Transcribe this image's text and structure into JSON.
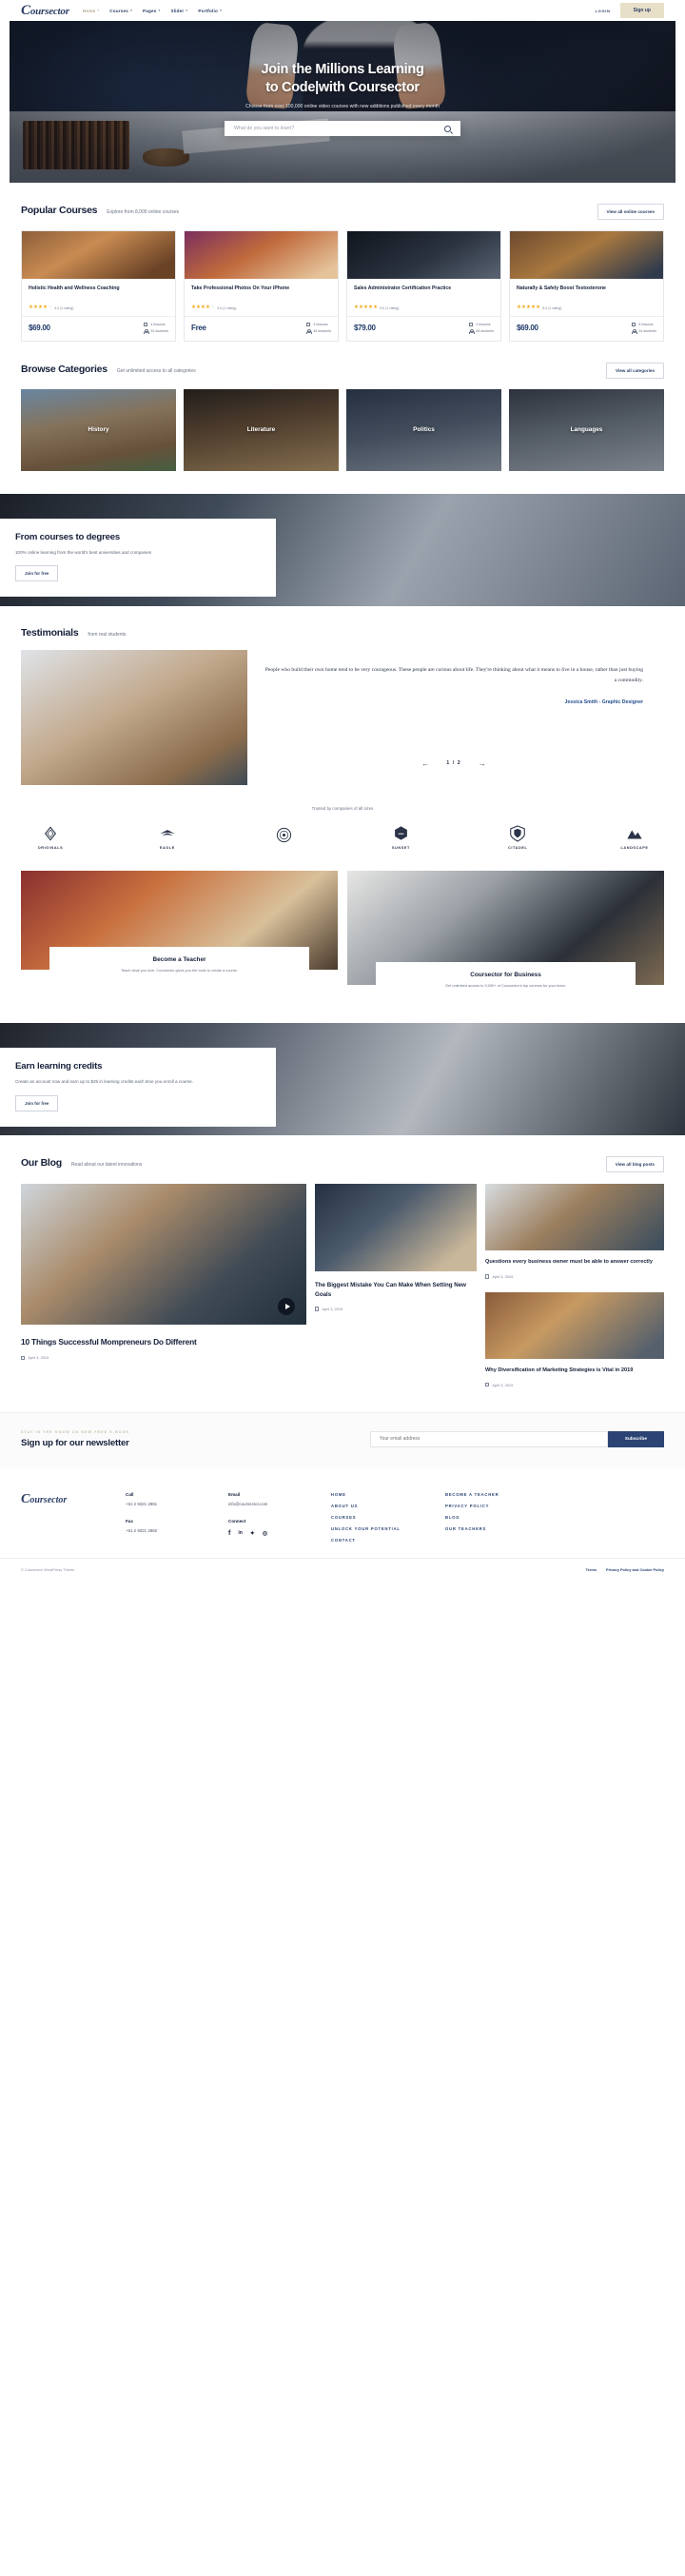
{
  "header": {
    "logo": "Coursector",
    "nav": [
      {
        "label": "Home",
        "caret": true,
        "muted": true
      },
      {
        "label": "Courses",
        "caret": true,
        "muted": false
      },
      {
        "label": "Pages",
        "caret": true,
        "muted": false
      },
      {
        "label": "Slider",
        "caret": true,
        "muted": false
      },
      {
        "label": "Portfolio",
        "caret": true,
        "muted": false
      }
    ],
    "login_label": "LOGIN",
    "signup_label": "Sign up"
  },
  "hero": {
    "title_line1": "Join the Millions Learning",
    "title_line2": "to Code|with Coursector",
    "subtitle": "Choose from over 100,000 online video courses with new additions published every month",
    "search_placeholder": "What do you want to learn?",
    "search_value": "",
    "search_icon": "search-icon"
  },
  "popular": {
    "title": "Popular Courses",
    "subtitle": "Explore from 8,000 online courses",
    "button": "View all online courses",
    "courses": [
      {
        "title": "Holistic Health and Wellness Coaching",
        "rating": 4.0,
        "stars_full": 4,
        "rating_text": "4.0 (1 rating)",
        "price": "$69.00",
        "lessons": "4 lessons",
        "students": "32 students"
      },
      {
        "title": "Take Professional Photos On Your iPhone",
        "rating": 4.0,
        "stars_full": 4,
        "rating_text": "4.0 (1 rating)",
        "price": "Free",
        "lessons": "4 lessons",
        "students": "45 students"
      },
      {
        "title": "Sales Administrator Certification Practice",
        "rating": 5.0,
        "stars_full": 5,
        "rating_text": "5.0 (1 rating)",
        "price": "$79.00",
        "lessons": "3 lessons",
        "students": "65 students"
      },
      {
        "title": "Naturally & Safely Boost Testosterone",
        "rating": 5.0,
        "stars_full": 5,
        "rating_text": "5.0 (1 rating)",
        "price": "$69.00",
        "lessons": "6 lessons",
        "students": "34 students"
      }
    ]
  },
  "categories": {
    "title": "Browse Categories",
    "subtitle": "Get unlimited access to all categories",
    "button": "View all categories",
    "items": [
      {
        "label": "History"
      },
      {
        "label": "Literature"
      },
      {
        "label": "Politics"
      },
      {
        "label": "Languages"
      }
    ]
  },
  "degrees_banner": {
    "title": "From courses to degrees",
    "text": "100% online learning from the world's best universities and companies",
    "button": "Join for free"
  },
  "testimonials": {
    "title": "Testimonials",
    "subtitle": "from real students",
    "quote": "People who build their own home tend to be very courageous. These people are curious about life. They're thinking about what it means to live in a house, rather than just buying a commodity.",
    "author": "Jessica Smith - Graphic Designer",
    "page": "1 / 2",
    "prev_icon": "arrow-left-icon",
    "next_icon": "arrow-right-icon"
  },
  "trusted": {
    "label": "Trusted by companies of all sizes",
    "brands": [
      {
        "name": "ORIGINALS",
        "mark": "diamond-icon"
      },
      {
        "name": "EAGLE",
        "mark": "eagle-icon"
      },
      {
        "name": "",
        "mark": "circle-emblem-icon"
      },
      {
        "name": "SUNSET",
        "mark": "hexagon-icon"
      },
      {
        "name": "CITADEL",
        "mark": "shield-icon"
      },
      {
        "name": "LANDSCAPE",
        "mark": "mountain-icon"
      }
    ]
  },
  "promos": [
    {
      "title": "Become a Teacher",
      "text": "Teach what you love. Coursector gives you the tools to create a course."
    },
    {
      "title": "Coursector for Business",
      "text": "Get unlimited access to 3,000+ of Coursector's top courses for your team."
    }
  ],
  "credits_banner": {
    "title": "Earn learning credits",
    "text": "Create an account now and earn up to $25 in learning credits each time you enroll a course.",
    "button": "Join for free"
  },
  "blog": {
    "title": "Our Blog",
    "subtitle": "Read about our latest innovations",
    "button": "View all blog posts",
    "main": {
      "title": "10 Things Successful Mompreneurs Do Different",
      "date": "April 3, 2019",
      "play_icon": "play-icon"
    },
    "mid": {
      "title": "The Biggest Mistake You Can Make When Setting New Goals",
      "date": "April 3, 2019"
    },
    "right": [
      {
        "title": "Questions every business owner must be able to answer correctly",
        "date": "April 3, 2019"
      },
      {
        "title": "Why Diversification of Marketing Strategies is Vital in 2019",
        "date": "April 3, 2019"
      }
    ]
  },
  "newsletter": {
    "kicker": "STAY IN THE KNOW ON NEW FREE E-BOOK",
    "title": "Sign up for our newsletter",
    "placeholder": "Your email address",
    "value": "",
    "button": "Subscribe"
  },
  "footer": {
    "logo": "Coursector",
    "call_label": "Call",
    "call_value": "+61 2 9321 2881",
    "fax_label": "Fax",
    "fax_value": "+61 2 9321 2882",
    "email_label": "Email",
    "email_value": "info@coursector.com",
    "connect_label": "Connect",
    "socials": [
      {
        "name": "facebook-icon",
        "glyph": "f"
      },
      {
        "name": "linkedin-icon",
        "glyph": "in"
      },
      {
        "name": "twitter-icon",
        "glyph": "🐦"
      },
      {
        "name": "instagram-icon",
        "glyph": "◎"
      }
    ],
    "links_col1": [
      "HOME",
      "ABOUT US",
      "COURSES",
      "UNLOCK YOUR POTENTIAL",
      "CONTACT"
    ],
    "links_col2": [
      "BECOME A TEACHER",
      "PRIVACY POLICY",
      "BLOG",
      "OUR TEACHERS"
    ],
    "copyright": "© Coursector WordPress Theme",
    "bottom_links": [
      "Terms",
      "Privacy Policy and Cookie Policy"
    ]
  }
}
